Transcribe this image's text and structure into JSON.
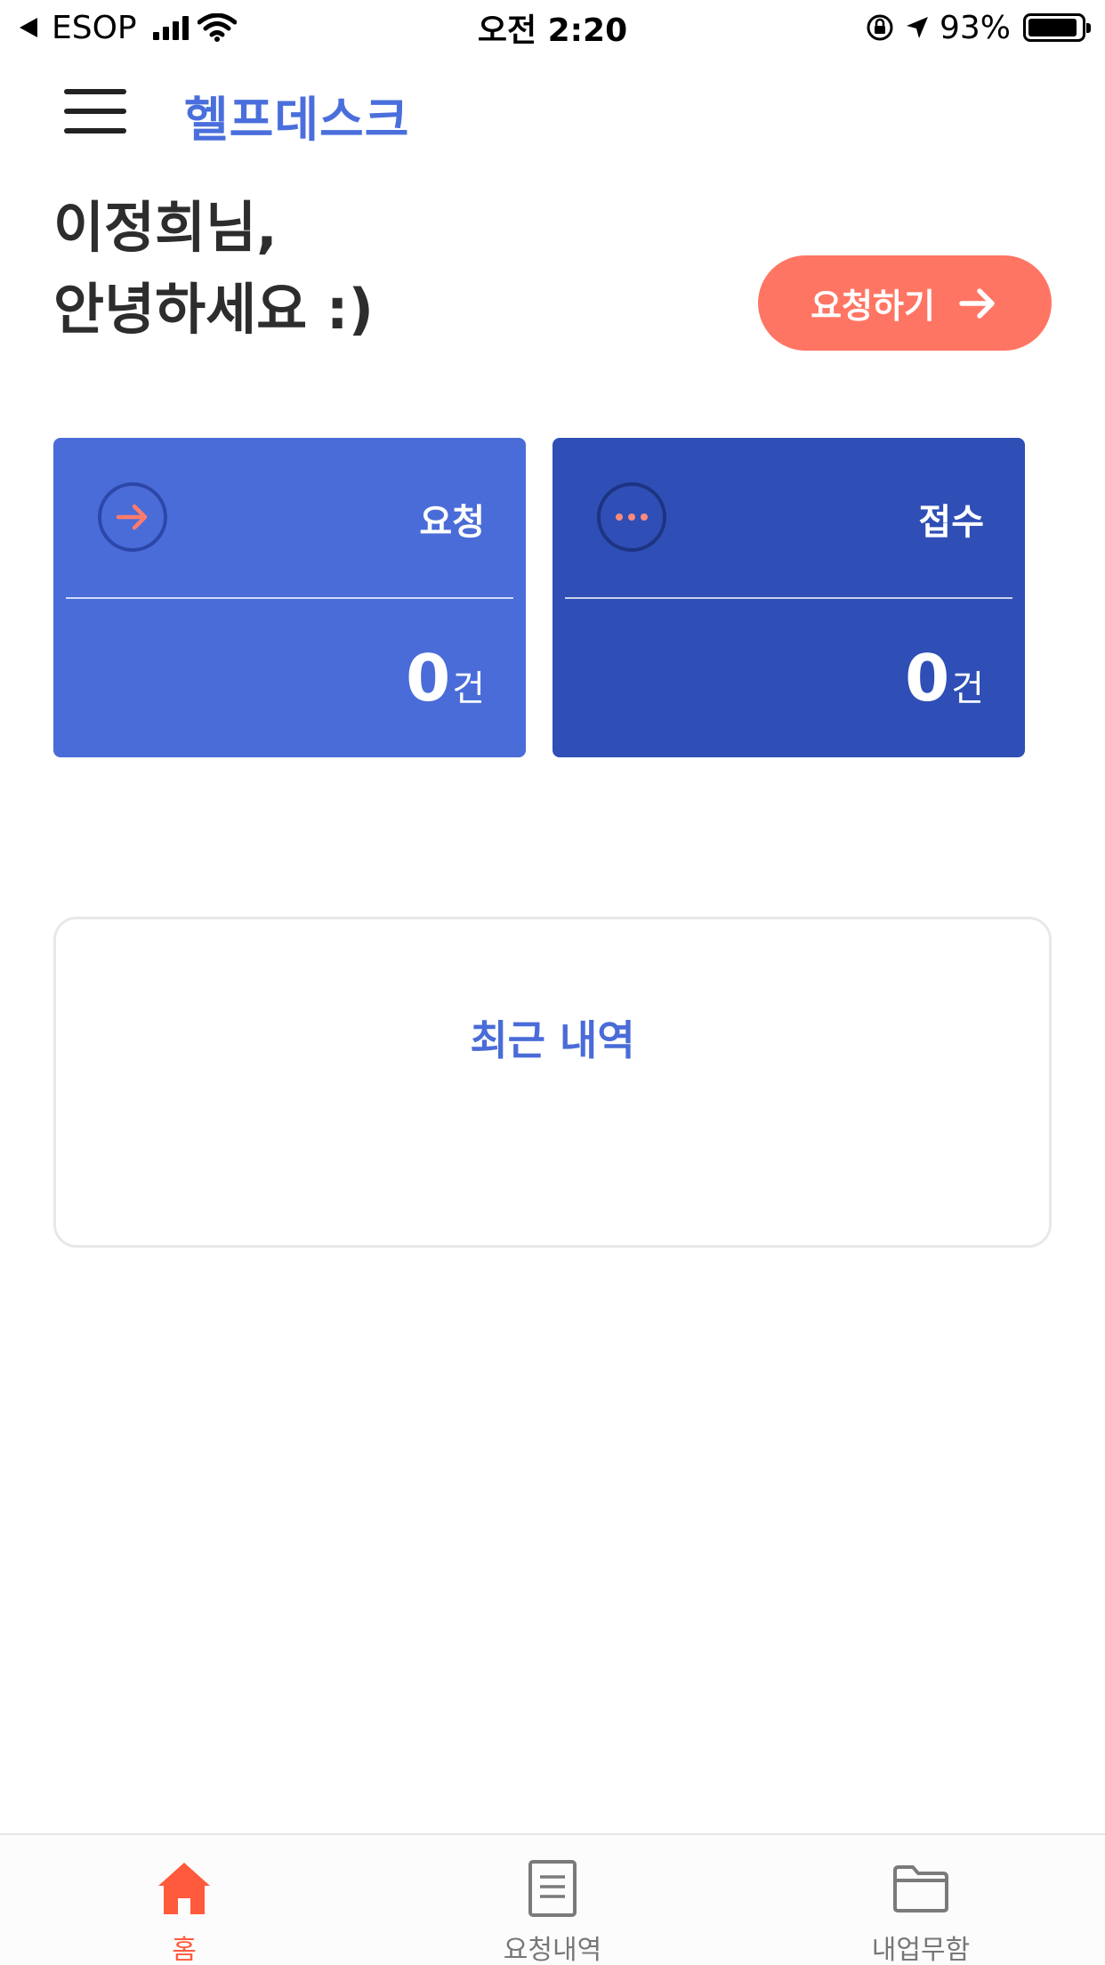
{
  "status_bar": {
    "carrier": "ESOP",
    "time": "오전 2:20",
    "battery": "93%",
    "battery_level": 0.93
  },
  "header": {
    "title": "헬프데스크",
    "menu_icon": "hamburger-menu-icon"
  },
  "greeting": {
    "line1": "이정희님,",
    "line2": "안녕하세요 :)"
  },
  "request_button": {
    "label": "요청하기",
    "icon": "arrow-right-icon"
  },
  "cards": [
    {
      "label": "요청",
      "count": "0",
      "unit": "건",
      "icon": "arrow-right-circle-icon",
      "color": "#4a6cd8"
    },
    {
      "label": "접수",
      "count": "0",
      "unit": "건",
      "icon": "ellipsis-circle-icon",
      "color": "#2f4fb6"
    }
  ],
  "recent": {
    "title": "최근 내역"
  },
  "bottom_nav": {
    "items": [
      {
        "label": "홈",
        "icon": "home-icon",
        "active": true
      },
      {
        "label": "요청내역",
        "icon": "document-icon",
        "active": false
      },
      {
        "label": "내업무함",
        "icon": "folder-icon",
        "active": false
      }
    ]
  },
  "colors": {
    "accent": "#ff7563",
    "primary": "#4a6cd8",
    "primary_dark": "#2f4fb6",
    "active_nav": "#ff5a3c"
  }
}
